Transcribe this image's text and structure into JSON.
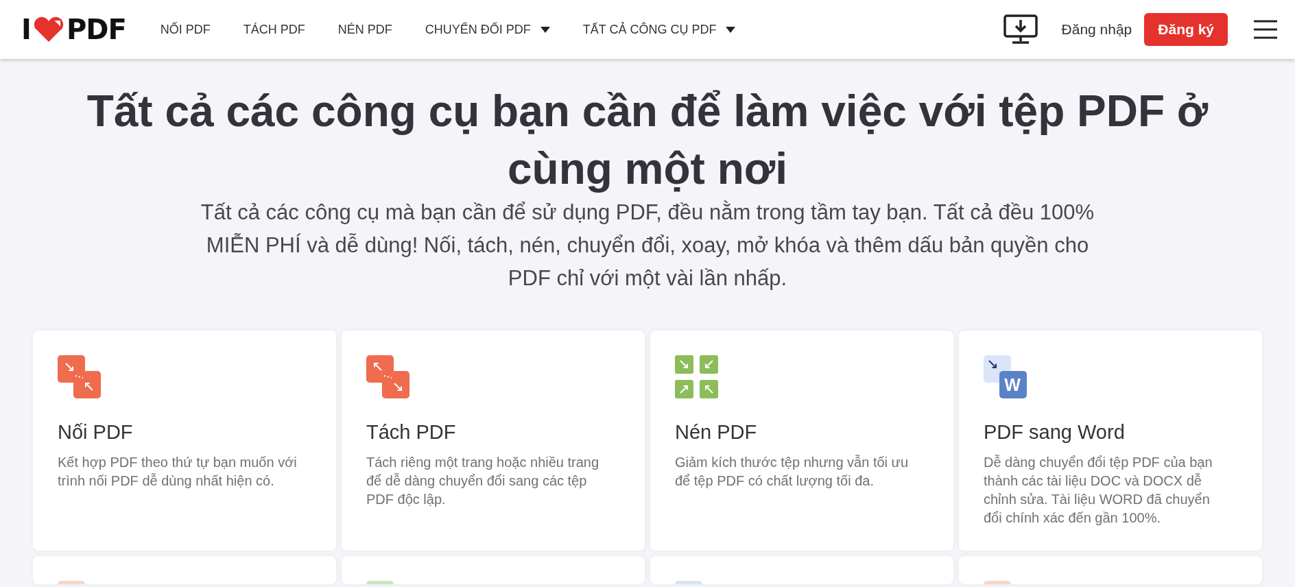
{
  "header": {
    "logo": {
      "left": "I",
      "right": "PDF"
    },
    "nav": [
      {
        "label": "NỐI PDF",
        "dropdown": false
      },
      {
        "label": "TÁCH PDF",
        "dropdown": false
      },
      {
        "label": "NÉN PDF",
        "dropdown": false
      },
      {
        "label": "CHUYỂN ĐỔI PDF",
        "dropdown": true
      },
      {
        "label": "TẤT CẢ CÔNG CỤ PDF",
        "dropdown": true
      }
    ],
    "login": "Đăng nhập",
    "signup": "Đăng ký"
  },
  "hero": {
    "title": "Tất cả các công cụ bạn cần để làm việc với tệp PDF ở cùng một nơi",
    "subtitle": "Tất cả các công cụ mà bạn cần để sử dụng PDF, đều nằm trong tầm tay bạn. Tất cả đều 100% MIỄN PHÍ và dễ dùng! Nối, tách, nén, chuyển đổi, xoay, mở khóa và thêm dấu bản quyền cho PDF chỉ với một vài lần nhấp."
  },
  "tools": [
    {
      "kind": "merge",
      "title": "Nối PDF",
      "description": "Kết hợp PDF theo thứ tự bạn muốn với trình nối PDF dễ dùng nhất hiện có."
    },
    {
      "kind": "split",
      "title": "Tách PDF",
      "description": "Tách riêng một trang hoặc nhiều trang để dễ dàng chuyển đổi sang các tệp PDF độc lập."
    },
    {
      "kind": "compress",
      "title": "Nén PDF",
      "description": "Giảm kích thước tệp nhưng vẫn tối ưu để tệp PDF có chất lượng tối đa."
    },
    {
      "kind": "word",
      "title": "PDF sang Word",
      "description": "Dễ dàng chuyển đổi tệp PDF của bạn thành các tài liệu DOC và DOCX dễ chỉnh sửa. Tài liệu WORD đã chuyển đổi chính xác đến gần 100%.",
      "icon_letter": "W"
    },
    {
      "kind": "cut",
      "color": "#f4d8c8"
    },
    {
      "kind": "cut",
      "color": "#c8e6c0"
    },
    {
      "kind": "cut",
      "color": "#d9e3f7"
    },
    {
      "kind": "cut",
      "color": "#f4d8c8"
    }
  ]
}
